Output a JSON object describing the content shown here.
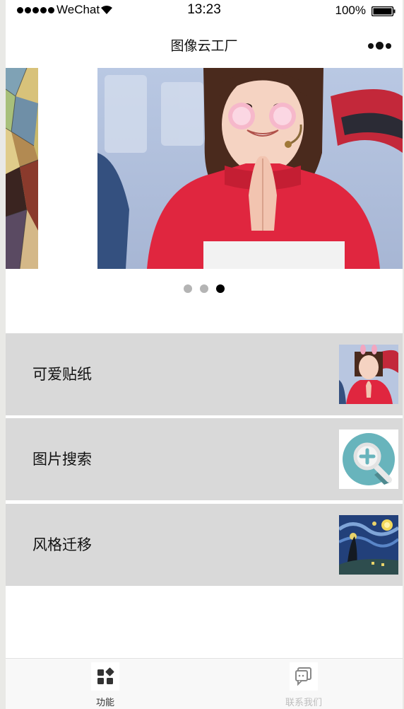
{
  "status_bar": {
    "carrier": "WeChat",
    "time": "13:23",
    "battery": "100%"
  },
  "nav": {
    "title": "图像云工厂",
    "more_icon": "more-dots-icon"
  },
  "carousel": {
    "slide_count": 3,
    "active_index": 2
  },
  "menu": {
    "items": [
      {
        "label": "可爱贴纸",
        "thumb_icon": "sticker-photo-thumb"
      },
      {
        "label": "图片搜索",
        "thumb_icon": "magnifier-plus-icon"
      },
      {
        "label": "风格迁移",
        "thumb_icon": "starry-night-thumb"
      }
    ]
  },
  "tabbar": {
    "tabs": [
      {
        "label": "功能",
        "icon": "grid-icon",
        "color": "#333333"
      },
      {
        "label": "联系我们",
        "icon": "chat-icon",
        "color": "#bdbdbd"
      }
    ]
  },
  "colors": {
    "menu_bg": "#d9d9d9",
    "dot_inactive": "#b4b4b4",
    "dot_active": "#000000",
    "accent_red": "#e0263f"
  }
}
